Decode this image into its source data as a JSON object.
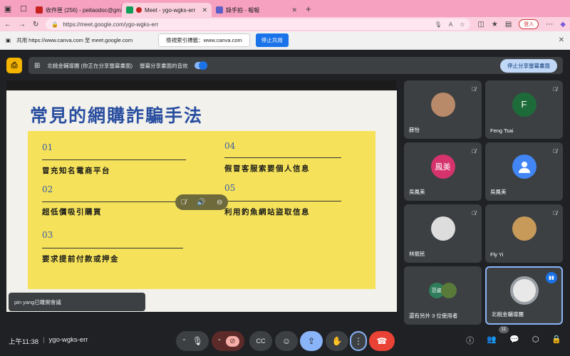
{
  "browser": {
    "tabs": [
      {
        "title": "收件匣 (256) - peitaodoc@gma",
        "color": "#c5221f",
        "active": false
      },
      {
        "title": "Meet - ygo-wgks-err",
        "color": "#0f9d58",
        "active": true
      },
      {
        "title": "錄手拍 - 報報",
        "color": "#5b5fc7",
        "active": false
      }
    ],
    "url": "https://meet.google.com/ygo-wgks-err",
    "login_label": "登入"
  },
  "sharebar": {
    "message": "共用 https://www.canva.com 至 meet.google.com",
    "view_label": "檢視索引標籤：www.canva.com",
    "stop_label": "停止共用"
  },
  "present": {
    "status": "北桃金輔導團 (你正在分享螢幕畫面)",
    "audio_label": "螢幕分享畫面的音效",
    "stop_label": "停止分享螢幕畫面"
  },
  "slide": {
    "title": "常見的網購詐騙手法",
    "items": [
      {
        "num": "01",
        "text": "冒充知名電商平台"
      },
      {
        "num": "02",
        "text": "超低價吸引購買"
      },
      {
        "num": "03",
        "text": "要求提前付款或押金"
      },
      {
        "num": "04",
        "text": "假冒客服索要個人信息"
      },
      {
        "num": "05",
        "text": "利用釣魚網站盜取信息"
      }
    ]
  },
  "toast": "pin yang已離開會議",
  "participants": [
    {
      "name": "薛怡",
      "avatar": "photo",
      "color": "#b98a6a"
    },
    {
      "name": "Feng Tsai",
      "avatar": "F",
      "color": "#1e6b3a"
    },
    {
      "name": "吳鳳美",
      "avatar": "鳳美",
      "color": "#d6336c"
    },
    {
      "name": "吳鳳美",
      "avatar": "person",
      "color": "#4285f4"
    },
    {
      "name": "林振民",
      "avatar": "photo",
      "color": "#dddddd"
    },
    {
      "name": "Fly Yi",
      "avatar": "photo",
      "color": "#c89a5a"
    },
    {
      "name": "還有另外 3 位使用者",
      "avatar": "范姿",
      "color": "#2f7d5a"
    },
    {
      "name": "北桃金輔導團",
      "avatar": "photo",
      "color": "#e8e8e8"
    }
  ],
  "bottom": {
    "time": "上午11:38",
    "meeting_code": "ygo-wgks-err",
    "people_count": "11"
  }
}
